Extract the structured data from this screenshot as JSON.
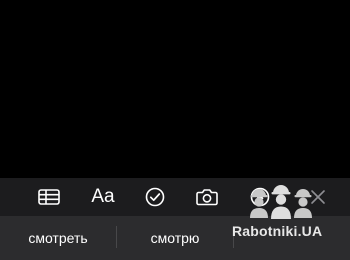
{
  "toolbar": {
    "items": [
      {
        "name": "table-icon"
      },
      {
        "name": "text-format",
        "label": "Aa"
      },
      {
        "name": "checklist-icon"
      },
      {
        "name": "camera-icon"
      },
      {
        "name": "markup-pen-icon"
      },
      {
        "name": "close-icon"
      }
    ]
  },
  "suggestions": {
    "items": [
      {
        "label": "смотреть"
      },
      {
        "label": "смотрю"
      },
      {
        "label": ""
      }
    ]
  },
  "watermark": {
    "text": "Rabotniki.UA"
  },
  "colors": {
    "background": "#000000",
    "toolbar": "#1c1c1e",
    "suggestion_bar": "#2c2c2e",
    "icon": "#ffffff",
    "close_icon": "#8e8e93"
  }
}
